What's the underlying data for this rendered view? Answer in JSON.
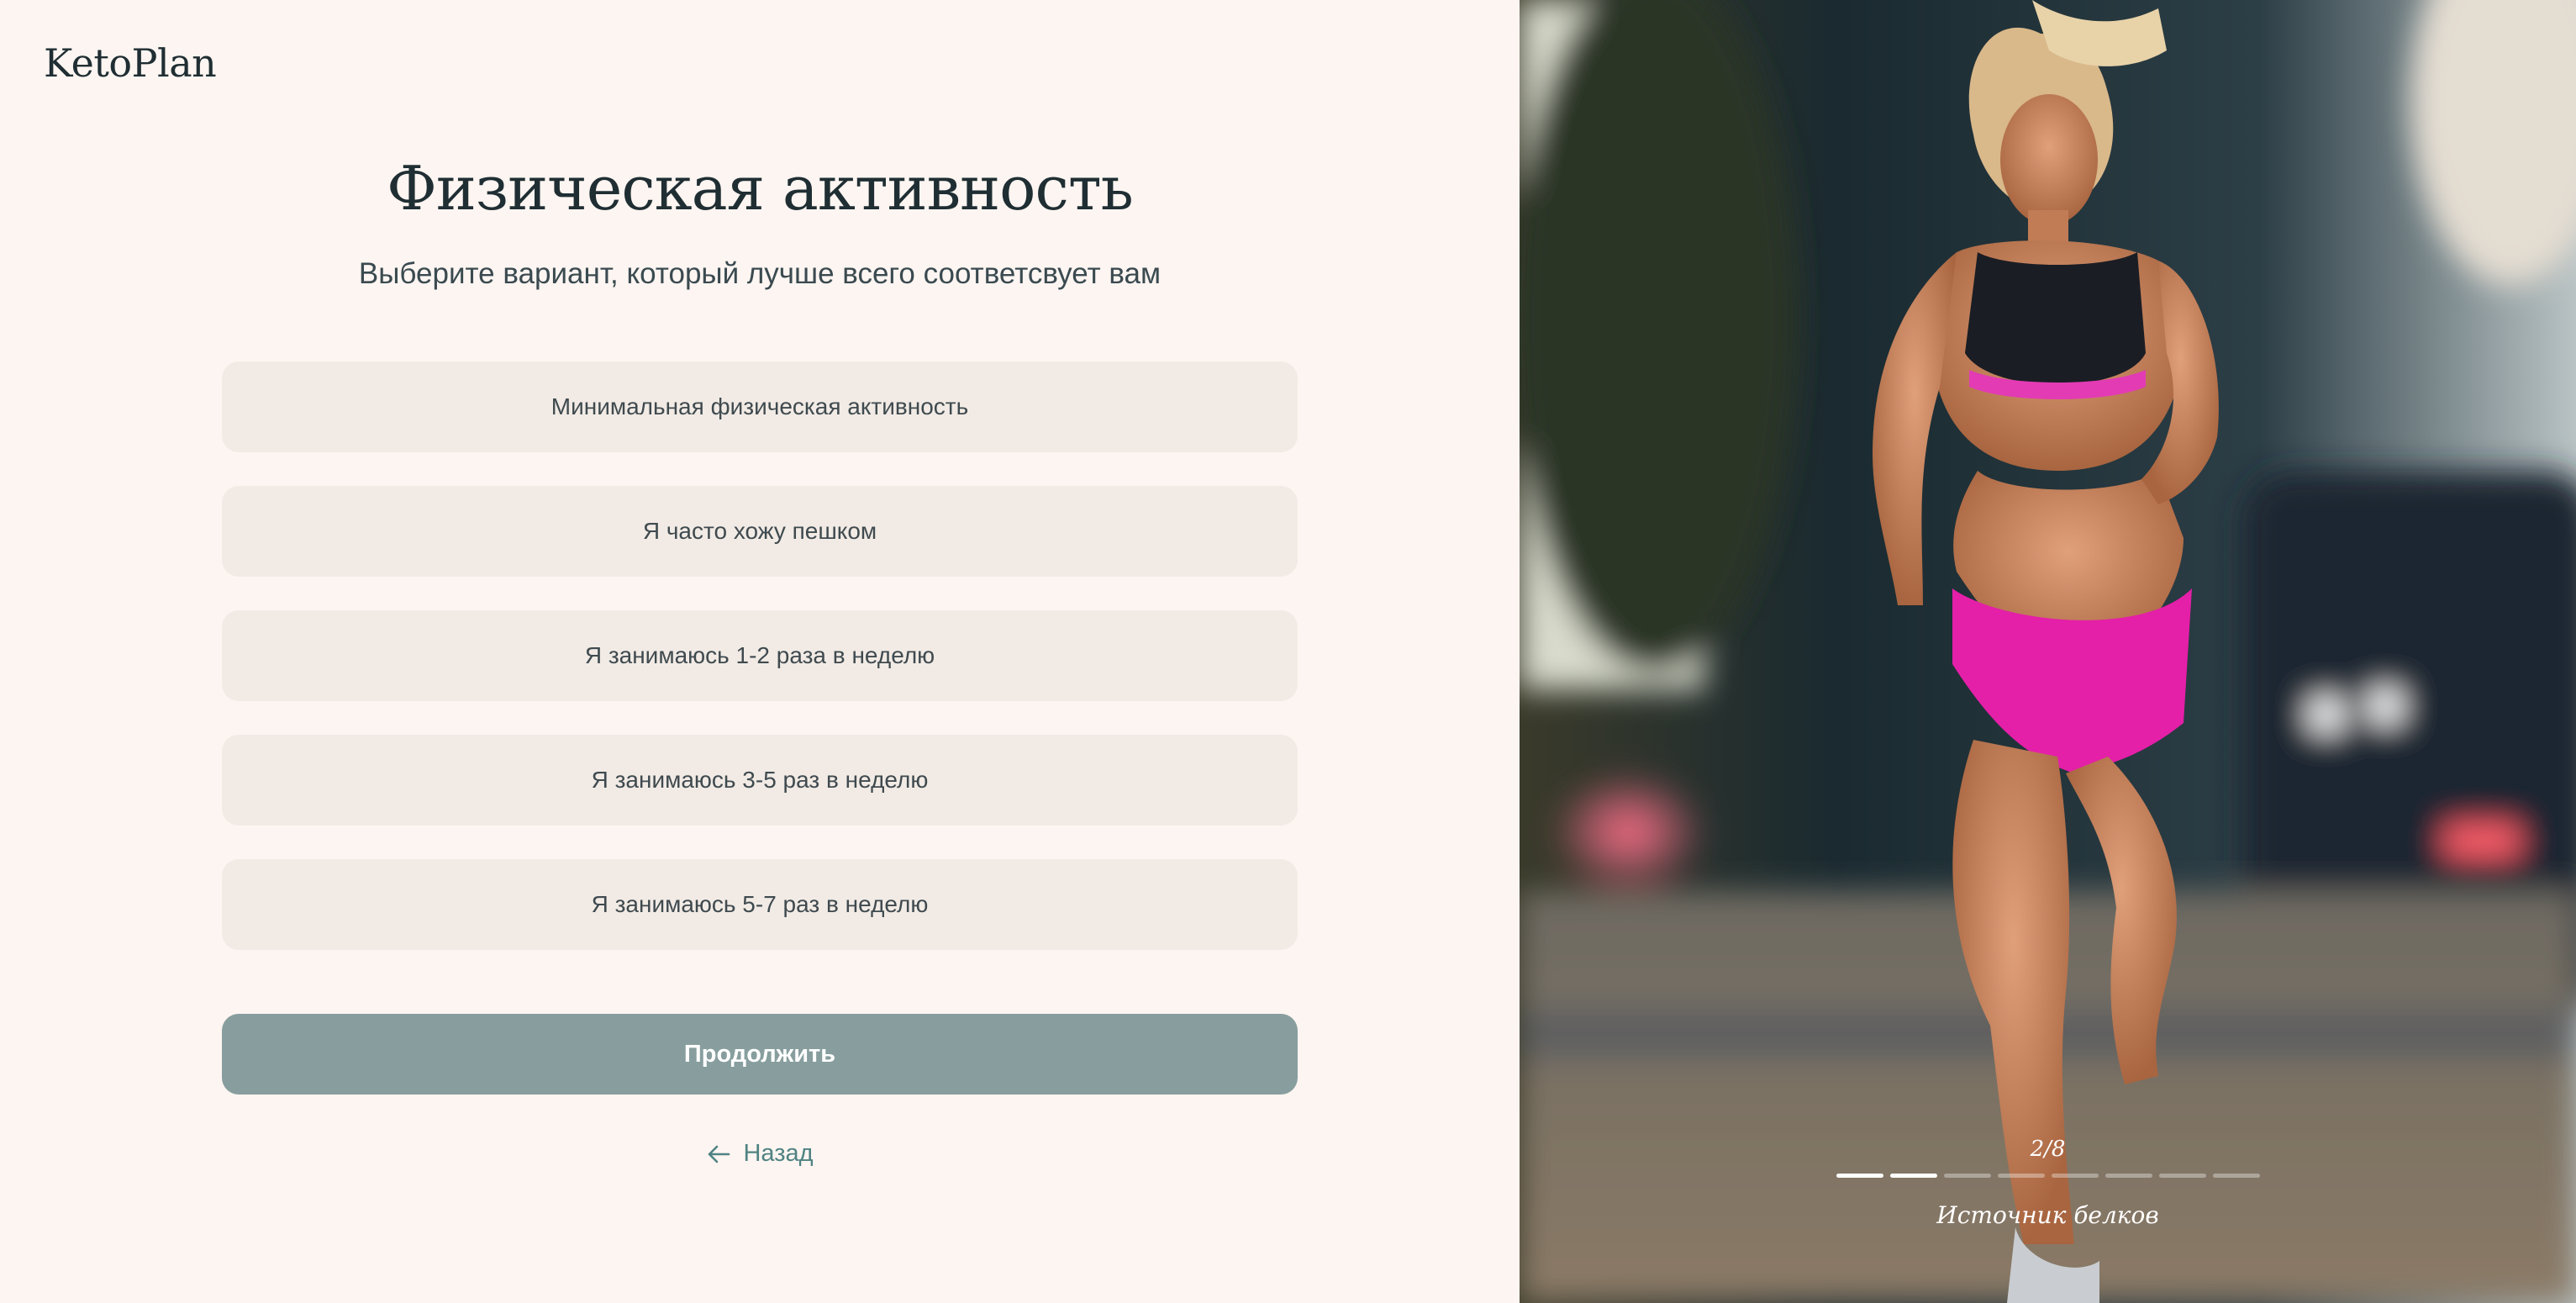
{
  "brand": {
    "logo": "KetoPlan"
  },
  "header": {
    "title": "Физическая активность",
    "subtitle": "Выберите вариант, который лучше всего соответсвует вам"
  },
  "options": [
    {
      "label": "Минимальная физическая активность"
    },
    {
      "label": "Я часто хожу пешком"
    },
    {
      "label": "Я занимаюсь 1-2 раза в неделю"
    },
    {
      "label": "Я занимаюсь 3-5 раз в неделю"
    },
    {
      "label": "Я занимаюсь 5-7 раз в неделю"
    }
  ],
  "actions": {
    "continue_label": "Продолжить",
    "back_label": "Назад"
  },
  "slideshow": {
    "counter": "2/8",
    "current": 2,
    "total": 8,
    "caption": "Источник белков",
    "image": "woman-running-photo"
  },
  "colors": {
    "background": "#fdf5f1",
    "option_bg": "#f2ebe5",
    "button": "#889e9e",
    "accent": "#4f8383",
    "text": "#1f2e33"
  }
}
